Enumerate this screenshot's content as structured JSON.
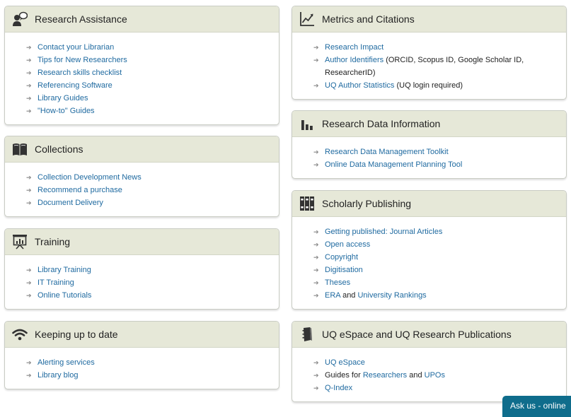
{
  "left": {
    "research_assistance": {
      "title": "Research Assistance",
      "icon": "user-speech-icon",
      "links": [
        "Contact your Librarian",
        "Tips for New Researchers",
        "Research skills checklist",
        "Referencing Software",
        "Library Guides",
        "\"How-to\" Guides"
      ]
    },
    "collections": {
      "title": "Collections",
      "icon": "book-icon",
      "links": [
        "Collection Development News",
        "Recommend a purchase",
        "Document Delivery"
      ]
    },
    "training": {
      "title": "Training",
      "icon": "presentation-icon",
      "links": [
        "Library Training",
        "IT Training",
        "Online Tutorials"
      ]
    },
    "keeping_up": {
      "title": "Keeping up to date",
      "icon": "wifi-icon",
      "links": [
        "Alerting services",
        "Library blog"
      ]
    }
  },
  "right": {
    "metrics": {
      "title": "Metrics and Citations",
      "icon": "line-chart-icon",
      "items": [
        {
          "link": "Research Impact",
          "text": ""
        },
        {
          "link": "Author Identifiers",
          "text": " (ORCID, Scopus ID, Google Scholar ID, ResearcherID)"
        },
        {
          "link": "UQ Author Statistics",
          "text": " (UQ login required)"
        }
      ]
    },
    "research_data": {
      "title": "Research Data Information",
      "icon": "bar-chart-icon",
      "links": [
        "Research Data Management Toolkit",
        "Online Data Management Planning Tool"
      ]
    },
    "scholarly": {
      "title": "Scholarly Publishing",
      "icon": "binders-icon",
      "links": [
        "Getting published: Journal Articles",
        "Open access",
        "Copyright",
        "Digitisation",
        "Theses"
      ],
      "era": {
        "link1": "ERA",
        "and": " and ",
        "link2": "University Rankings"
      }
    },
    "espace": {
      "title": "UQ eSpace and UQ Research Publications",
      "icon": "phone-book-icon",
      "espace_link": "UQ eSpace",
      "guides": {
        "prefix": "Guides for ",
        "link1": "Researchers",
        "and": " and ",
        "link2": "UPOs"
      },
      "qindex": "Q-Index"
    }
  },
  "chat": {
    "label": "Ask us - online"
  },
  "colors": {
    "header_bg": "#e6e8d8",
    "link": "#1f6aa0",
    "chat_bg": "#0f6d8c"
  }
}
